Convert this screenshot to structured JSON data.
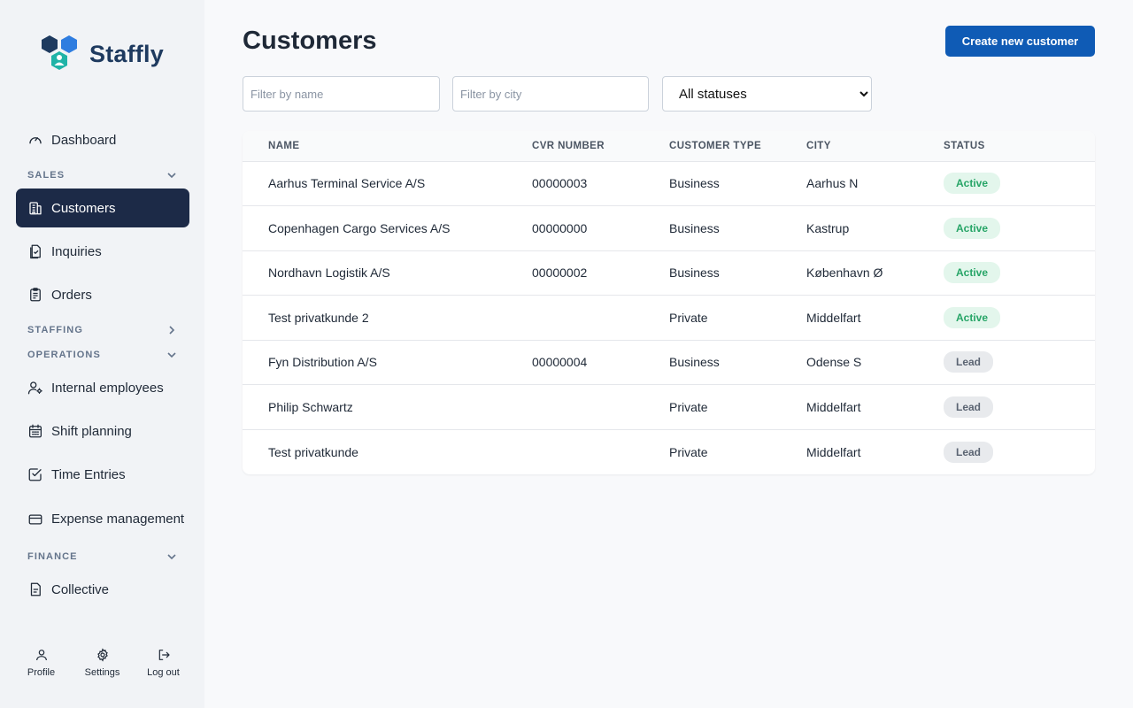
{
  "app": {
    "name": "Staffly",
    "brand_color": "#0f5bb5",
    "active_nav_color": "#1c2a47"
  },
  "sidebar": {
    "dashboard": {
      "label": "Dashboard",
      "icon": "gauge-icon"
    },
    "sections": {
      "sales": {
        "label": "SALES",
        "state": "expanded"
      },
      "staffing": {
        "label": "STAFFING",
        "state": "collapsed"
      },
      "operations": {
        "label": "OPERATIONS",
        "state": "expanded"
      },
      "finance": {
        "label": "FINANCE",
        "state": "expanded"
      }
    },
    "items": {
      "customers": {
        "label": "Customers",
        "icon": "building-icon",
        "active": true
      },
      "inquiries": {
        "label": "Inquiries",
        "icon": "inquiry-icon"
      },
      "orders": {
        "label": "Orders",
        "icon": "clipboard-icon"
      },
      "internal_employees": {
        "label": "Internal employees",
        "icon": "user-gear-icon"
      },
      "shift_planning": {
        "label": "Shift planning",
        "icon": "calendar-icon"
      },
      "time_entries": {
        "label": "Time Entries",
        "icon": "checkbox-icon"
      },
      "expense_management": {
        "label": "Expense management",
        "icon": "credit-card-icon"
      },
      "collective": {
        "label": "Collective",
        "icon": "document-icon"
      }
    },
    "bottom": {
      "profile": "Profile",
      "settings": "Settings",
      "logout": "Log out"
    }
  },
  "main": {
    "title": "Customers",
    "create_button": "Create new customer",
    "filters": {
      "name_placeholder": "Filter by name",
      "city_placeholder": "Filter by city",
      "status_selected": "All statuses"
    },
    "table": {
      "headers": {
        "name": "NAME",
        "cvr": "CVR NUMBER",
        "type": "CUSTOMER TYPE",
        "city": "CITY",
        "status": "STATUS"
      },
      "rows": [
        {
          "name": "Aarhus Terminal Service A/S",
          "cvr": "00000003",
          "type": "Business",
          "city": "Aarhus N",
          "status": "Active"
        },
        {
          "name": "Copenhagen Cargo Services A/S",
          "cvr": "00000000",
          "type": "Business",
          "city": "Kastrup",
          "status": "Active"
        },
        {
          "name": "Nordhavn Logistik A/S",
          "cvr": "00000002",
          "type": "Business",
          "city": "København Ø",
          "status": "Active"
        },
        {
          "name": "Test privatkunde 2",
          "cvr": "",
          "type": "Private",
          "city": "Middelfart",
          "status": "Active"
        },
        {
          "name": "Fyn Distribution A/S",
          "cvr": "00000004",
          "type": "Business",
          "city": "Odense S",
          "status": "Lead"
        },
        {
          "name": "Philip Schwartz",
          "cvr": "",
          "type": "Private",
          "city": "Middelfart",
          "status": "Lead"
        },
        {
          "name": "Test privatkunde",
          "cvr": "",
          "type": "Private",
          "city": "Middelfart",
          "status": "Lead"
        }
      ]
    },
    "status_colors": {
      "Active": {
        "bg": "#e3f6ec",
        "fg": "#27a567"
      },
      "Lead": {
        "bg": "#e8eaed",
        "fg": "#5b6472"
      }
    }
  }
}
